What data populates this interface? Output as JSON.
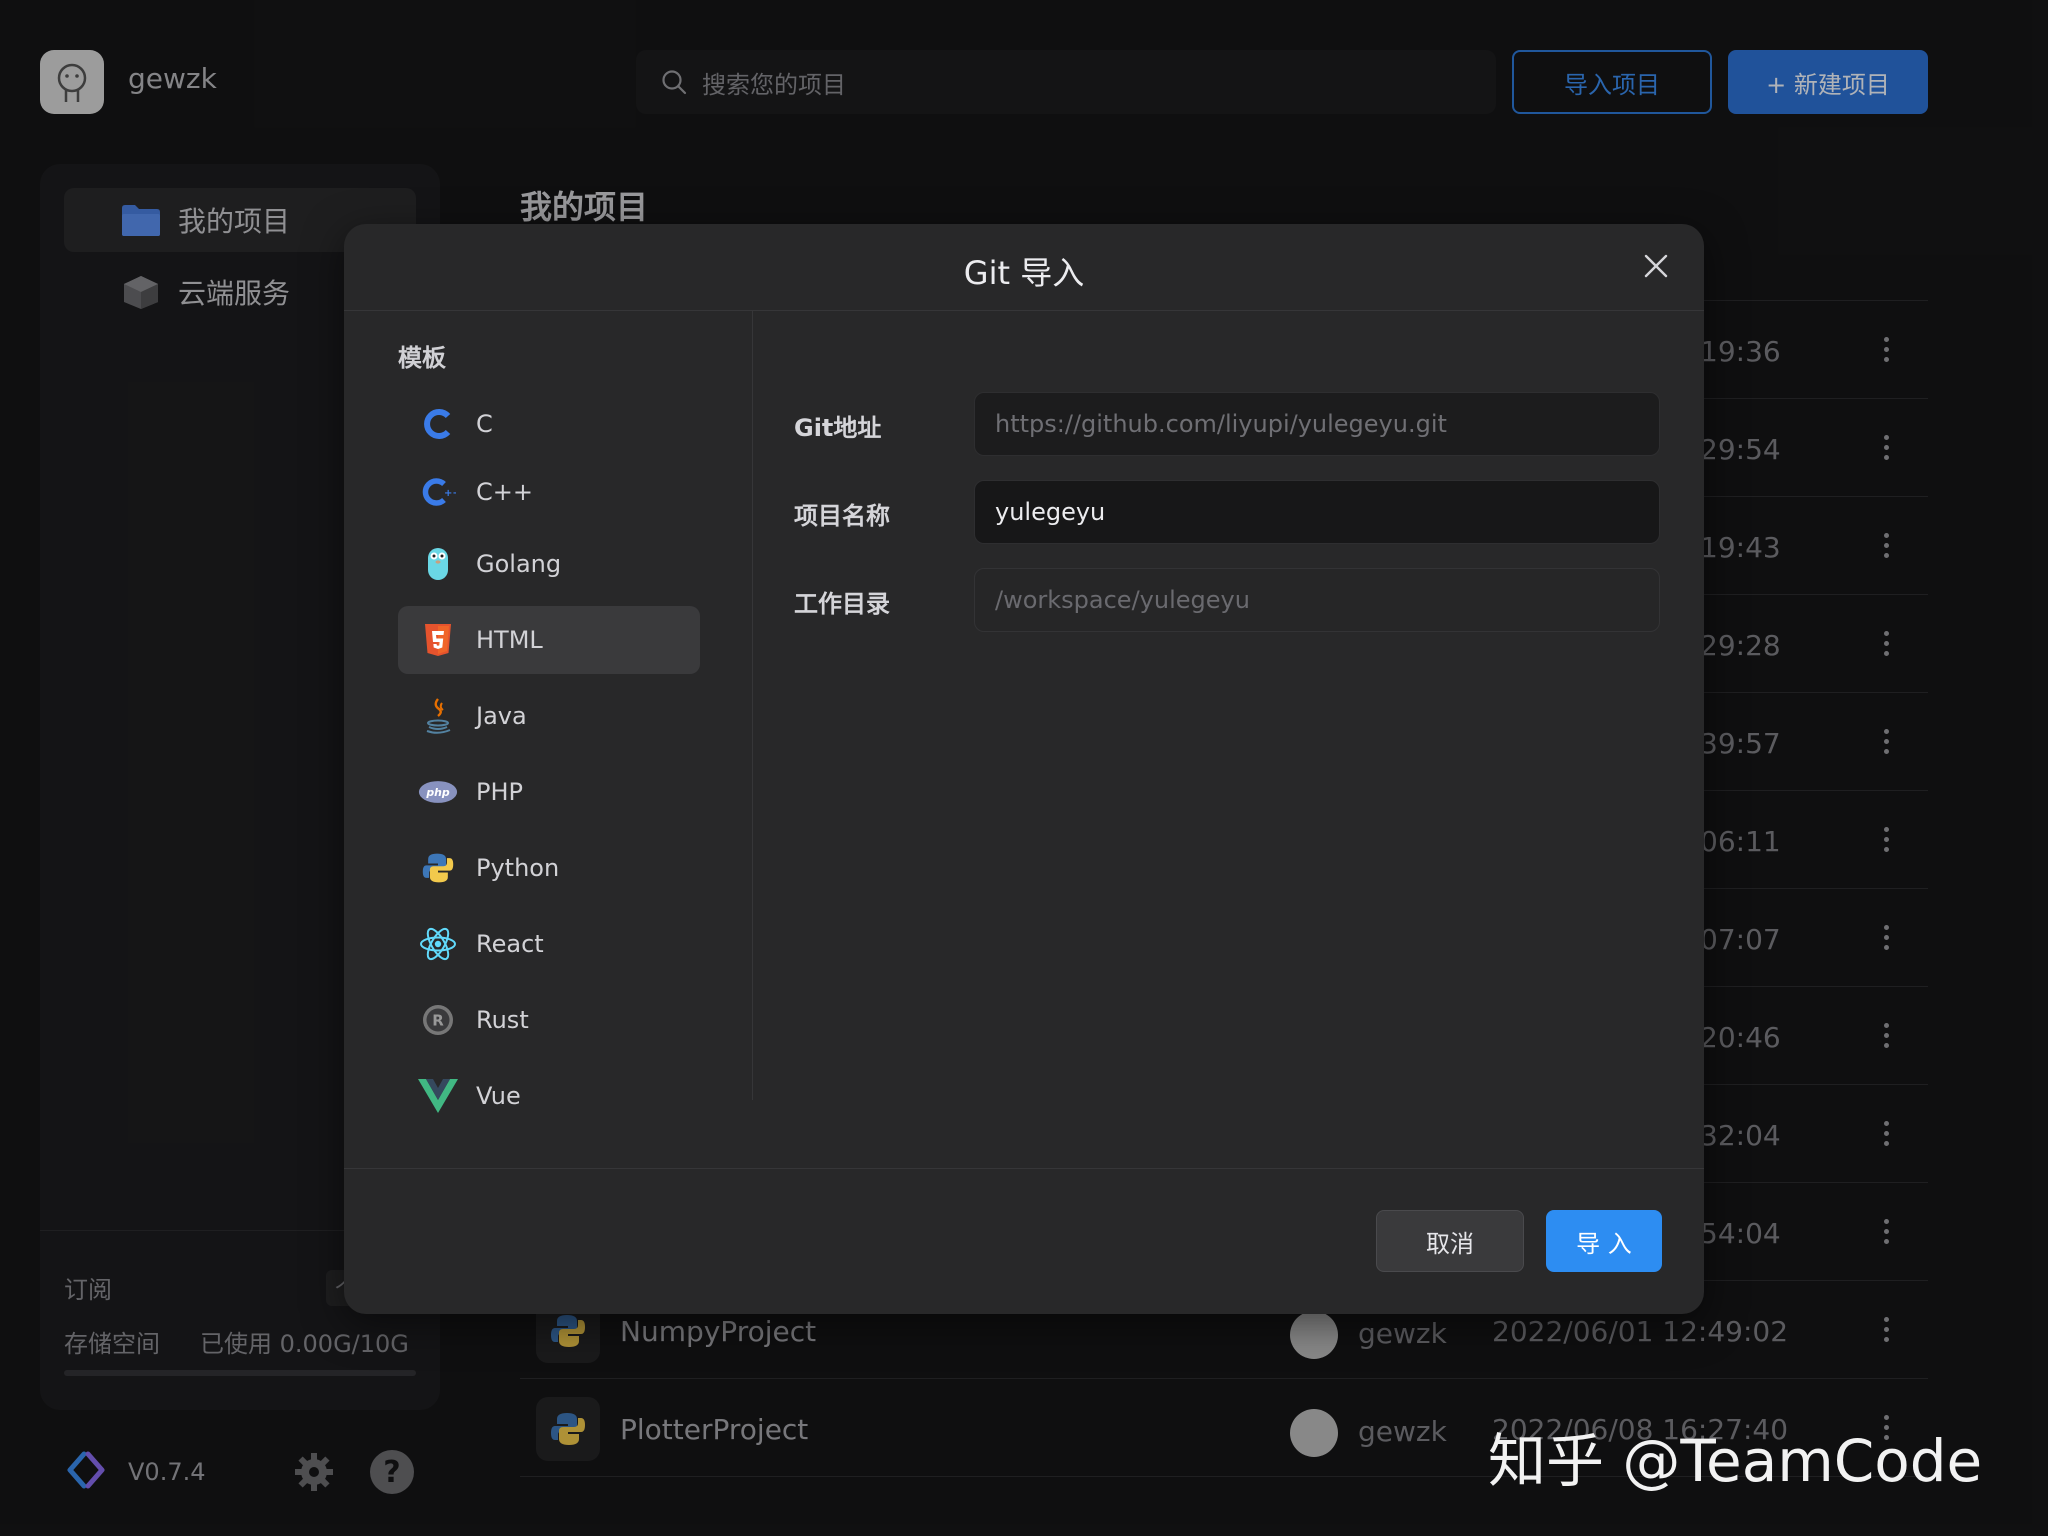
{
  "header": {
    "username": "gewzk",
    "search_placeholder": "搜索您的项目",
    "import_button": "导入项目",
    "new_button": "+ 新建项目"
  },
  "sidebar": {
    "items": [
      {
        "label": "我的项目",
        "icon": "folder-icon"
      },
      {
        "label": "云端服务",
        "icon": "cloud-cube-icon"
      }
    ],
    "subscription_label": "订阅",
    "subscription_toggle": "个",
    "storage_label": "存储空间",
    "storage_used": "已使用 0.00G/10G",
    "version": "V0.7.4"
  },
  "main": {
    "title": "我的项目",
    "rows": [
      {
        "time": "19:36"
      },
      {
        "time": "29:54"
      },
      {
        "time": "19:43"
      },
      {
        "time": "29:28"
      },
      {
        "time": "39:57"
      },
      {
        "time": "06:11"
      },
      {
        "time": "07:07"
      },
      {
        "time": "20:46"
      },
      {
        "time": "32:04"
      },
      {
        "time": "54:04"
      },
      {
        "name": "NumpyProject",
        "owner": "gewzk",
        "time": "2022/06/01 12:49:02"
      },
      {
        "name": "PlotterProject",
        "owner": "gewzk",
        "time": "2022/06/08 16:27:40"
      }
    ]
  },
  "modal": {
    "title": "Git 导入",
    "template_label": "模板",
    "templates": [
      {
        "label": "C",
        "icon": "c-lang-icon"
      },
      {
        "label": "C++",
        "icon": "cpp-lang-icon"
      },
      {
        "label": "Golang",
        "icon": "gopher-icon"
      },
      {
        "label": "HTML",
        "icon": "html5-icon"
      },
      {
        "label": "Java",
        "icon": "java-cup-icon"
      },
      {
        "label": "PHP",
        "icon": "php-icon"
      },
      {
        "label": "Python",
        "icon": "python-icon"
      },
      {
        "label": "React",
        "icon": "react-atom-icon"
      },
      {
        "label": "Rust",
        "icon": "rust-gear-icon"
      },
      {
        "label": "Vue",
        "icon": "vue-icon"
      }
    ],
    "selected_template": "HTML",
    "fields": {
      "git_label": "Git地址",
      "git_placeholder": "https://github.com/liyupi/yulegeyu.git",
      "name_label": "项目名称",
      "name_value": "yulegeyu",
      "dir_label": "工作目录",
      "dir_value": "/workspace/yulegeyu"
    },
    "cancel_button": "取消",
    "confirm_button": "导 入"
  },
  "watermark": "知乎 @TeamCode",
  "colors": {
    "accent": "#2d8df2",
    "background": "#161617",
    "modal": "#282829"
  }
}
